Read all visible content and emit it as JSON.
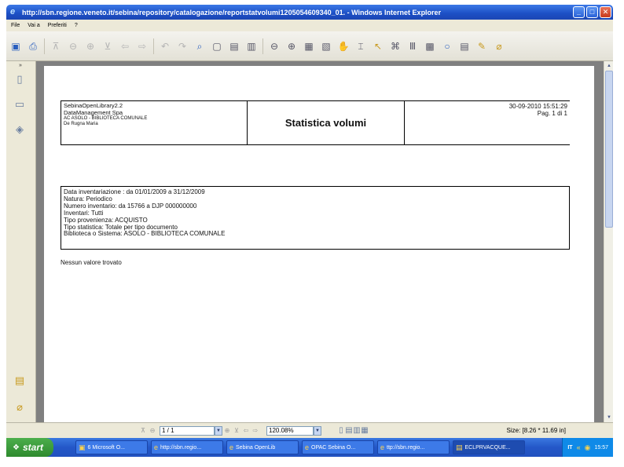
{
  "window": {
    "title": "http://sbn.regione.veneto.it/sebina/repository/catalogazione/reportstatvolumi1205054609340_01. - Windows Internet Explorer",
    "btn_min": "_",
    "btn_max": "□",
    "btn_close": "✕"
  },
  "menu": [
    "File",
    "Vai a",
    "Preferiti",
    "?"
  ],
  "report": {
    "left_lines": [
      "SebinaOpenLibrary2.2",
      "DataManagement Spa"
    ],
    "left_small": [
      "AC ASOLO - BIBLIOTECA COMUNALE",
      "De Rugna Maria"
    ],
    "title": "Statistica volumi",
    "datetime": "30-09-2010 15:51:29",
    "page": "Pag. 1 di 1"
  },
  "criteria": [
    "Data inventariazione : da 01/01/2009 a 31/12/2009",
    "Natura: Periodico",
    "Numero inventario: da 15766 a DJP 000000000",
    "Inventari: Tutti",
    "Tipo provenienza: ACQUISTO",
    "Tipo statistica: Totale per tipo documento",
    "Biblioteca o Sistema: ASOLO - BIBLIOTECA COMUNALE"
  ],
  "no_results": "Nessun valore trovato",
  "navbar": {
    "page_field": "1 / 1",
    "zoom_field": "120.08%",
    "size": "Size: [8.26 * 11.69 in]"
  },
  "taskbar": {
    "start": "start",
    "tasks": [
      "6 Microsoft O...",
      "http://sbn.regio...",
      "Sebina OpenLib",
      "OPAC Sebina O...",
      "ttp://sbn.regio...",
      "ECLPRVACQUE..."
    ],
    "lang": "IT",
    "clock": "15:57"
  }
}
